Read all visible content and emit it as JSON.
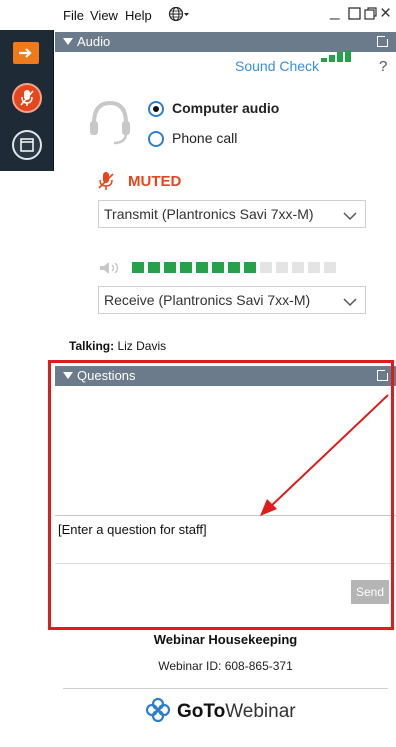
{
  "menubar": {
    "file": "File",
    "view": "View",
    "help": "Help",
    "window_controls": [
      "minimize",
      "maximize",
      "restore",
      "close"
    ]
  },
  "side_strip": {
    "icons": [
      "arrow-right-icon",
      "microphone-muted-icon",
      "window-icon"
    ]
  },
  "audio": {
    "header": "Audio",
    "sound_check": "Sound Check",
    "help_mark": "?",
    "options": [
      {
        "label": "Computer audio",
        "selected": true
      },
      {
        "label": "Phone call",
        "selected": false
      }
    ],
    "mute_status": "MUTED",
    "transmit_device": "Transmit (Plantronics Savi 7xx-M)",
    "receive_device": "Receive (Plantronics Savi 7xx-M)",
    "speaker_level_filled": 8,
    "speaker_level_total": 13
  },
  "talking": {
    "label": "Talking:",
    "name": "Liz Davis"
  },
  "questions": {
    "header": "Questions",
    "input_placeholder": "[Enter a question for staff]",
    "send_label": "Send"
  },
  "footer": {
    "title": "Webinar Housekeeping",
    "webinar_id": "Webinar ID: 608-865-371",
    "brand_bold": "GoTo",
    "brand_regular": "Webinar"
  },
  "colors": {
    "header_bar": "#6b7b8c",
    "accent_orange": "#f07a1a",
    "muted_red": "#e6461e",
    "link_blue": "#3a8fd6",
    "level_green": "#27a04a",
    "highlight_red": "#e01b1b"
  }
}
